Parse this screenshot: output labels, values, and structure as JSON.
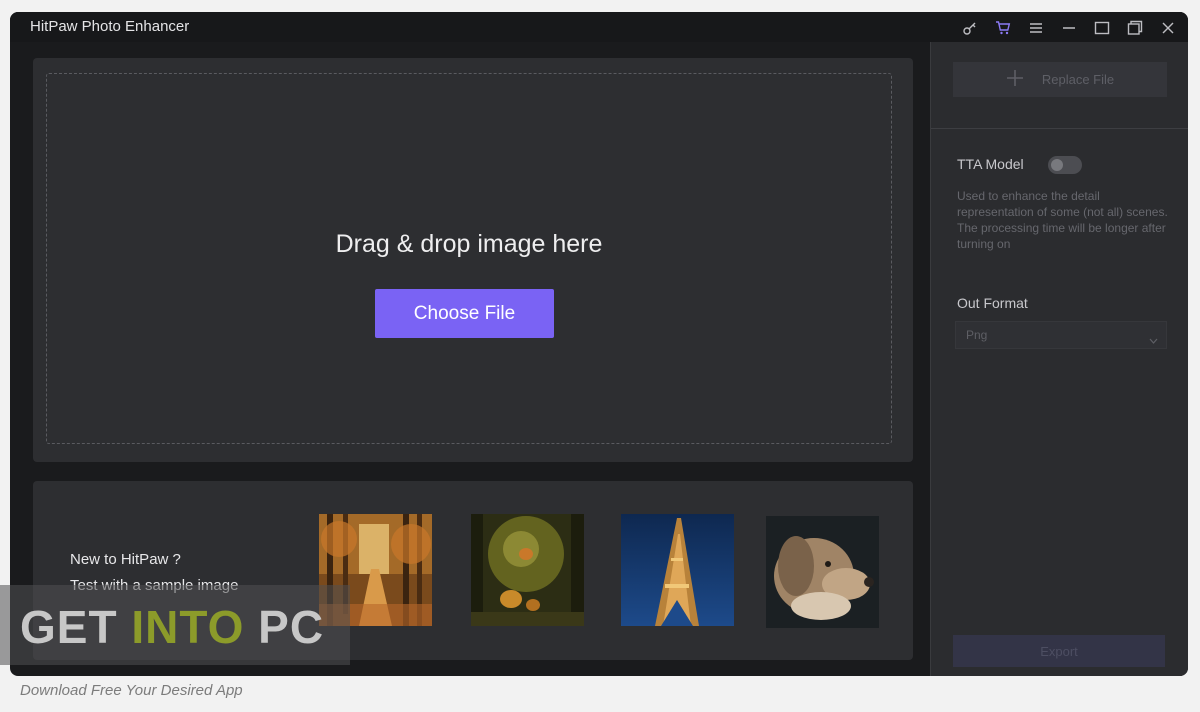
{
  "window": {
    "title": "HitPaw Photo Enhancer",
    "titlebar_icons": [
      "key-icon",
      "cart-icon",
      "menu-icon",
      "minimize-icon",
      "maximize-icon",
      "restore-icon",
      "close-icon"
    ],
    "accent_color": "#7a63f4"
  },
  "dropzone": {
    "prompt": "Drag & drop image here",
    "choose_label": "Choose File"
  },
  "samples": {
    "line1": "New to HitPaw ?",
    "line2": "Test with a sample image",
    "images": [
      "autumn-forest-path",
      "pumpkins-still-life",
      "eiffel-tower-night",
      "dog-portrait"
    ]
  },
  "sidebar": {
    "replace_label": "Replace File",
    "tta_label": "TTA Model",
    "tta_enabled": false,
    "tta_description": "Used to enhance the detail representation of some (not all) scenes. The processing time will be longer after turning on",
    "format_label": "Out Format",
    "format_value": "Png",
    "export_label": "Export"
  },
  "watermark": {
    "main_part1": "GET ",
    "main_part2": "INTO",
    "main_part3": " PC",
    "sub": "Download Free Your Desired App"
  }
}
